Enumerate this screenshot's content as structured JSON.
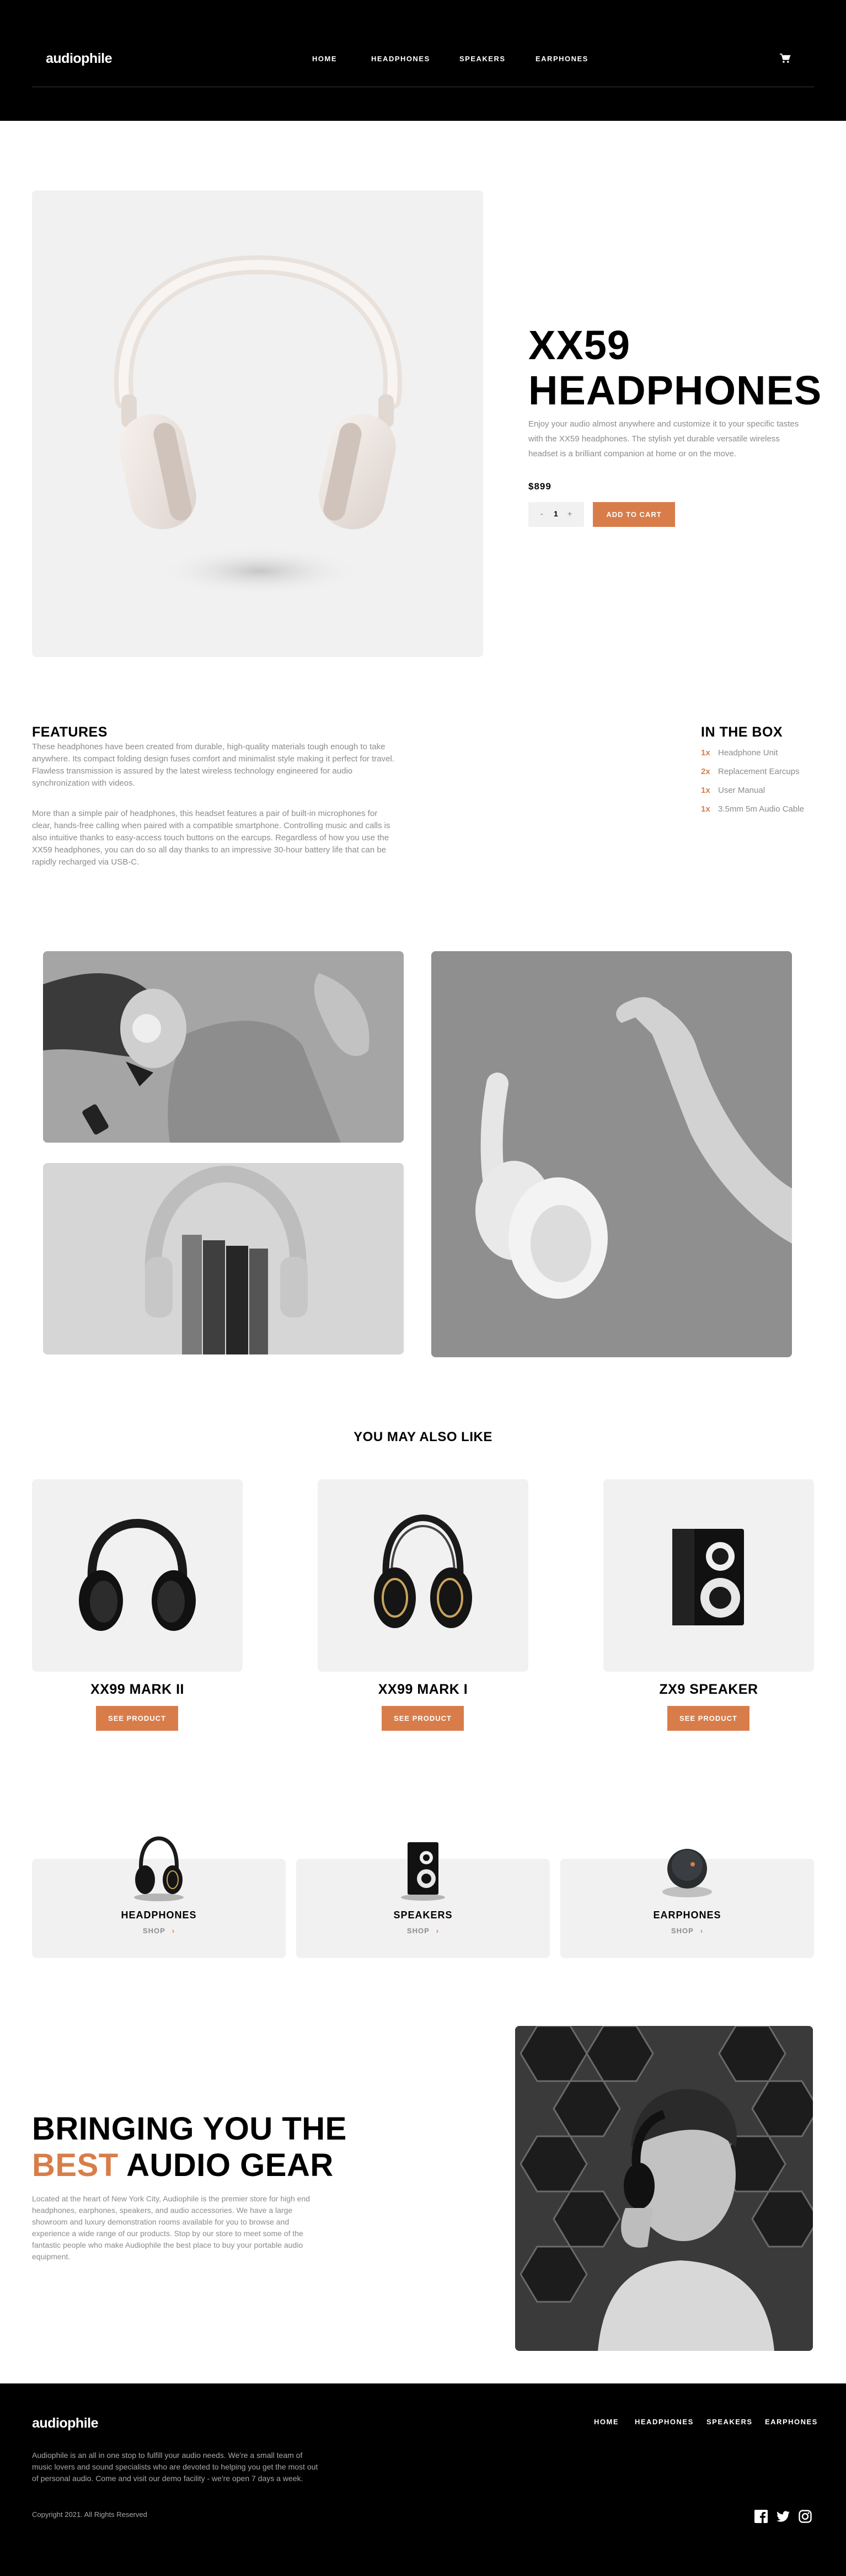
{
  "header": {
    "logo": "audiophile",
    "nav": [
      "HOME",
      "HEADPHONES",
      "SPEAKERS",
      "EARPHONES"
    ]
  },
  "product": {
    "title_line1": "XX59",
    "title_line2": "HEADPHONES",
    "description": "Enjoy your audio almost anywhere and customize it to your specific tastes with the XX59 headphones. The stylish yet durable versatile wireless headset is a brilliant companion at home or on the move.",
    "price": "$899",
    "quantity": "1",
    "qty_minus": "-",
    "qty_plus": "+",
    "add_to_cart": "ADD TO CART"
  },
  "features": {
    "heading": "FEATURES",
    "p1": "These headphones have been created from durable, high-quality materials tough enough to take anywhere. Its compact folding design fuses comfort and minimalist style making it perfect for travel. Flawless transmission is assured by the latest wireless technology engineered for audio synchronization with videos.",
    "p2": "More than a simple pair of headphones, this headset features a pair of built-in microphones for clear, hands-free calling when paired with a compatible smartphone. Controlling music and calls is also intuitive thanks to easy-access touch buttons on the earcups. Regardless of how you use the XX59 headphones, you can do so all day thanks to an impressive 30-hour battery life that can be rapidly recharged via USB-C."
  },
  "in_the_box": {
    "heading": "IN THE BOX",
    "items": [
      {
        "qty": "1x",
        "name": "Headphone Unit"
      },
      {
        "qty": "2x",
        "name": "Replacement Earcups"
      },
      {
        "qty": "1x",
        "name": "User Manual"
      },
      {
        "qty": "1x",
        "name": "3.5mm 5m Audio Cable"
      }
    ]
  },
  "also_like": {
    "heading": "YOU MAY ALSO LIKE",
    "products": [
      {
        "name": "XX99 MARK II",
        "button": "SEE PRODUCT"
      },
      {
        "name": "XX99 MARK I",
        "button": "SEE PRODUCT"
      },
      {
        "name": "ZX9 SPEAKER",
        "button": "SEE PRODUCT"
      }
    ]
  },
  "categories": [
    {
      "name": "HEADPHONES",
      "shop": "SHOP",
      "arrow": "›"
    },
    {
      "name": "SPEAKERS",
      "shop": "SHOP",
      "arrow": "›"
    },
    {
      "name": "EARPHONES",
      "shop": "SHOP",
      "arrow": "›"
    }
  ],
  "about": {
    "line1": "BRINGING YOU THE",
    "accent": "BEST",
    "line2_rest": " AUDIO GEAR",
    "text": "Located at the heart of New York City, Audiophile is the premier store for high end headphones, earphones, speakers, and audio accessories. We have a large showroom and luxury demonstration rooms available for you to browse and experience a wide range of our products. Stop by our store to meet some of the fantastic people who make Audiophile the best place to buy your portable audio equipment."
  },
  "footer": {
    "logo": "audiophile",
    "nav": [
      "HOME",
      "HEADPHONES",
      "SPEAKERS",
      "EARPHONES"
    ],
    "description": "Audiophile is an all in one stop to fulfill your audio needs. We're a small team of music lovers and sound specialists who are devoted to helping you get the most out of personal audio. Come and visit our demo facility - we're open 7 days a week.",
    "copyright": "Copyright 2021. All Rights Reserved",
    "social_icons": [
      "facebook-icon",
      "twitter-icon",
      "instagram-icon"
    ]
  },
  "colors": {
    "accent": "#d87d4a",
    "dark": "#000000",
    "light_gray": "#f1f1f1",
    "text_muted": "#8c8c8c"
  }
}
